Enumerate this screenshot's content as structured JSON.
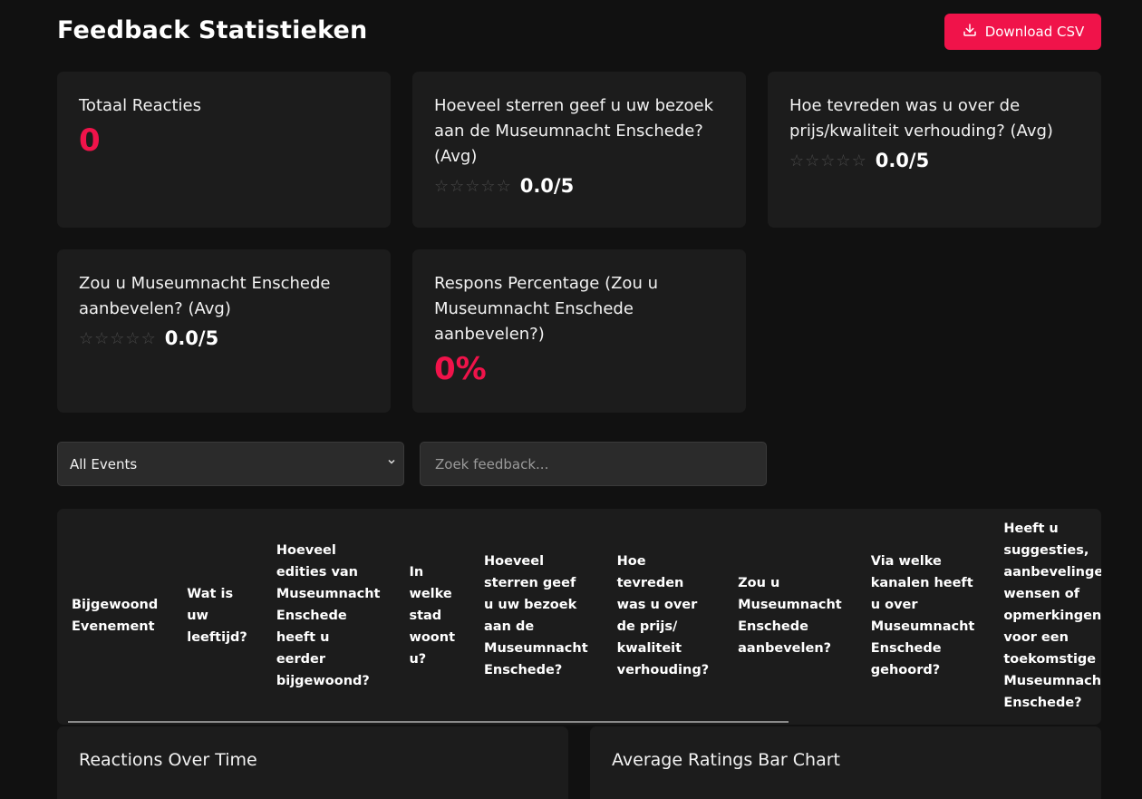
{
  "header": {
    "title": "Feedback Statistieken",
    "download_label": "Download CSV"
  },
  "stats": {
    "total": {
      "label": "Totaal Reacties",
      "value": "0"
    },
    "stars": {
      "label": "Hoeveel sterren geef u uw bezoek aan de Museumnacht Enschede? (Avg)",
      "value": "0.0/5",
      "rating": 0
    },
    "price": {
      "label": "Hoe tevreden was u over de prijs/kwaliteit verhouding? (Avg)",
      "value": "0.0/5",
      "rating": 0
    },
    "recommend": {
      "label": "Zou u Museumnacht Enschede aanbevelen? (Avg)",
      "value": "0.0/5",
      "rating": 0
    },
    "response": {
      "label": "Respons Percentage (Zou u Museumnacht Enschede aanbevelen?)",
      "value": "0%"
    }
  },
  "filters": {
    "event_selected": "All Events",
    "search_placeholder": "Zoek feedback..."
  },
  "table": {
    "headers": [
      "Bijgewoond Evenement",
      "Wat is uw leeftijd?",
      "Hoeveel edities van Museumnacht Enschede heeft u eerder bijgewoond?",
      "In welke stad woont u?",
      "Hoeveel sterren geef u uw bezoek aan de Museumnacht Enschede?",
      "Hoe tevreden was u over de prijs/ kwaliteit verhouding?",
      "Zou u Museumnacht Enschede aanbevelen?",
      "Via welke kanalen heeft u over Museumnacht Enschede gehoord?",
      "Heeft u suggesties, aanbevelingen wensen of opmerkingen voor een toekomstige Museumnacht Enschede?"
    ]
  },
  "charts": {
    "reactions_title": "Reactions Over Time",
    "ratings_title": "Average Ratings Bar Chart"
  },
  "colors": {
    "accent": "#f0134a",
    "background": "#111111",
    "card": "#1c1c1c"
  }
}
